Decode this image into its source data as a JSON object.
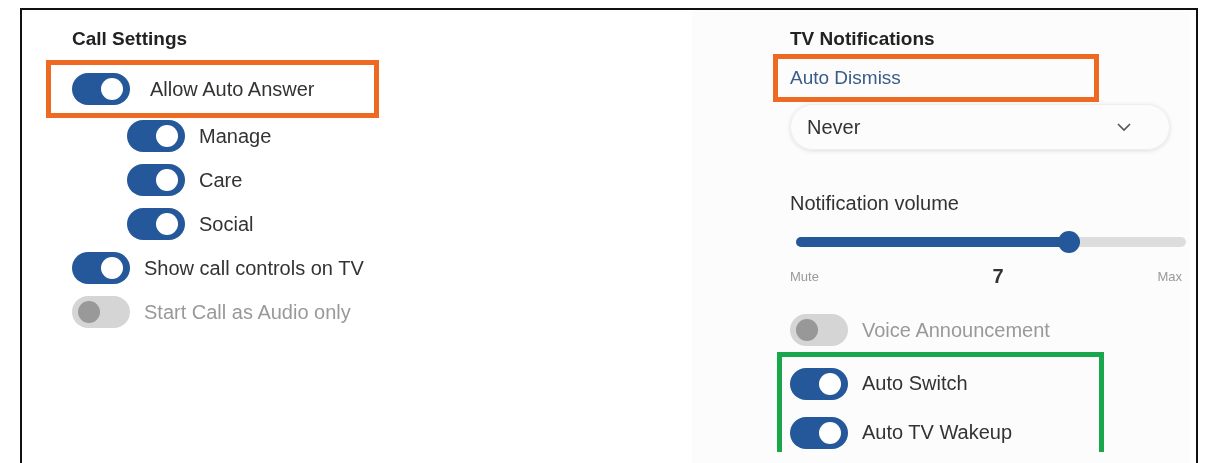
{
  "call_settings": {
    "title": "Call Settings",
    "toggles": [
      {
        "label": "Allow Auto Answer",
        "on": true,
        "disabled": false,
        "highlight": {
          "color": "#ee6a22"
        },
        "children": [
          {
            "label": "Manage",
            "on": true,
            "disabled": false
          },
          {
            "label": "Care",
            "on": true,
            "disabled": false
          },
          {
            "label": "Social",
            "on": true,
            "disabled": false
          }
        ]
      },
      {
        "label": "Show call controls on TV",
        "on": true,
        "disabled": false
      },
      {
        "label": "Start Call as Audio only",
        "on": false,
        "disabled": true
      }
    ]
  },
  "tv_notifications": {
    "title": "TV Notifications",
    "auto_dismiss": {
      "label": "Auto Dismiss",
      "highlight": {
        "color": "#ee6a22"
      },
      "value": "Never"
    },
    "volume": {
      "label": "Notification volume",
      "level": 0.7,
      "min_label": "Mute",
      "reading": "7",
      "max_label": "Max"
    },
    "toggles": [
      {
        "label": "Voice Announcement",
        "on": false,
        "disabled": true
      }
    ],
    "highlighted_group": {
      "color": "#1aa64b",
      "toggles": [
        {
          "label": "Auto Switch",
          "on": true,
          "disabled": false
        },
        {
          "label": "Auto TV Wakeup",
          "on": true,
          "disabled": false
        }
      ]
    }
  }
}
